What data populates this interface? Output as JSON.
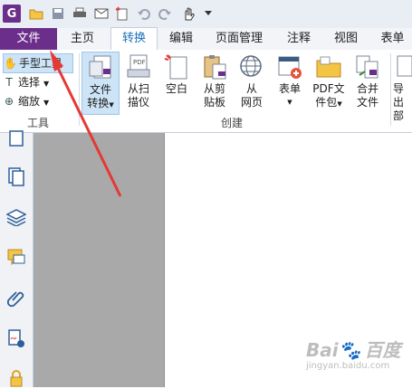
{
  "quick_access": {
    "app_icon": "G",
    "icons": [
      "open-folder-icon",
      "save-icon",
      "print-icon",
      "email-icon",
      "new-icon",
      "undo-icon",
      "redo-icon",
      "hand-icon",
      "customize-icon"
    ]
  },
  "tabs": [
    {
      "label": "文件"
    },
    {
      "label": "主页"
    },
    {
      "label": "转换"
    },
    {
      "label": "编辑"
    },
    {
      "label": "页面管理"
    },
    {
      "label": "注释"
    },
    {
      "label": "视图"
    },
    {
      "label": "表单"
    }
  ],
  "tools_group": {
    "hand": "手型工具",
    "select": "选择",
    "zoom": "缩放",
    "label": "工具"
  },
  "create_group": {
    "buttons": [
      {
        "line1": "文件",
        "line2": "转换"
      },
      {
        "line1": "从扫",
        "line2": "描仪"
      },
      {
        "line1": "空白",
        "line2": ""
      },
      {
        "line1": "从剪",
        "line2": "贴板"
      },
      {
        "line1": "从",
        "line2": "网页"
      },
      {
        "line1": "表单",
        "line2": ""
      },
      {
        "line1": "PDF文",
        "line2": "件包"
      },
      {
        "line1": "合并",
        "line2": "文件"
      },
      {
        "line1": "导出",
        "line2": "部"
      }
    ],
    "label": "创建"
  },
  "watermark": {
    "line1": "Bai",
    "brand": "百度",
    "line2": "jingyan.baidu.com"
  },
  "colors": {
    "file_tab": "#6b2e8a",
    "active_tab_text": "#1d6fb8",
    "arrow": "#e53935"
  }
}
